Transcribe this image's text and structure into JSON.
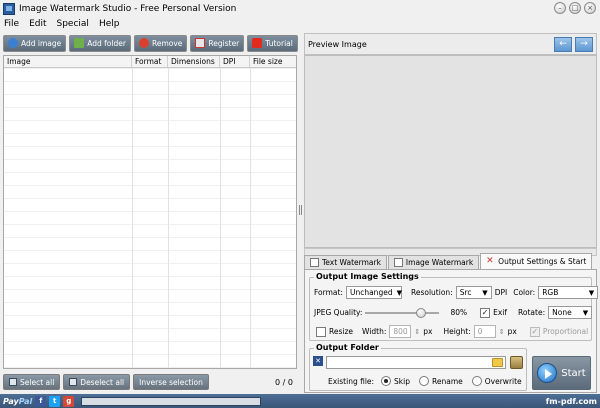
{
  "window": {
    "title": "Image Watermark Studio - Free Personal Version"
  },
  "menu": [
    "File",
    "Edit",
    "Special",
    "Help"
  ],
  "toolbar": {
    "add_image": "Add image",
    "add_folder": "Add folder",
    "remove": "Remove",
    "register": "Register",
    "tutorial": "Tutorial"
  },
  "file_list": {
    "columns": [
      "Image",
      "Format",
      "Dimensions",
      "DPI",
      "File size"
    ],
    "rows": [],
    "count": "0 / 0"
  },
  "selection": {
    "select_all": "Select all",
    "deselect_all": "Deselect all",
    "inverse": "Inverse selection"
  },
  "preview": {
    "title": "Preview Image"
  },
  "tabs": [
    "Text Watermark",
    "Image Watermark",
    "Output Settings & Start"
  ],
  "output_settings": {
    "title": "Output Image Settings",
    "format_label": "Format:",
    "format_value": "Unchanged",
    "resolution_label": "Resolution:",
    "resolution_value": "Src",
    "dpi_label": "DPI",
    "color_label": "Color:",
    "color_value": "RGB",
    "jpeg_label": "JPEG Quality:",
    "jpeg_value": "80%",
    "jpeg_fraction": 0.8,
    "exif_label": "Exif",
    "exif_checked": true,
    "rotate_label": "Rotate:",
    "rotate_value": "None",
    "resize_label": "Resize",
    "resize_checked": false,
    "width_label": "Width:",
    "width_value": "800",
    "height_label": "Height:",
    "height_value": "0",
    "px": "px",
    "proportional_label": "Proportional",
    "proportional_checked": true
  },
  "output_folder": {
    "title": "Output Folder",
    "path": "",
    "existing_label": "Existing file:",
    "options": [
      "Skip",
      "Rename",
      "Overwrite"
    ],
    "selected": "Skip"
  },
  "start": {
    "label": "Start"
  },
  "status": {
    "paypal_a": "Pay",
    "paypal_b": "Pal",
    "site": "fm-pdf.com"
  }
}
